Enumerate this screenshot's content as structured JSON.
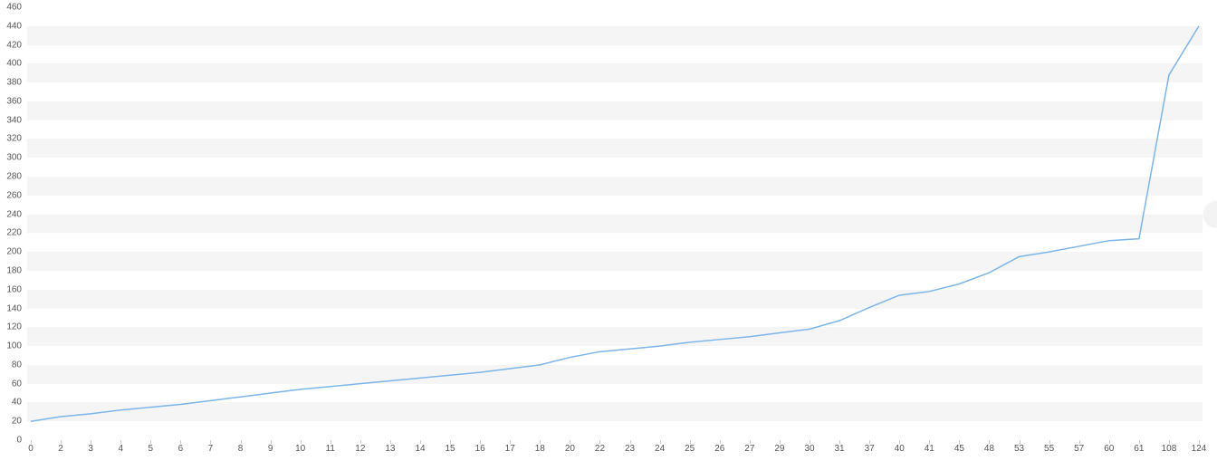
{
  "chart_data": {
    "type": "line",
    "categories": [
      "0",
      "2",
      "3",
      "4",
      "5",
      "6",
      "7",
      "8",
      "9",
      "10",
      "11",
      "12",
      "13",
      "14",
      "15",
      "16",
      "17",
      "18",
      "20",
      "22",
      "23",
      "24",
      "25",
      "26",
      "27",
      "29",
      "30",
      "31",
      "37",
      "40",
      "41",
      "45",
      "48",
      "53",
      "55",
      "57",
      "60",
      "61",
      "108",
      "124"
    ],
    "values": [
      20,
      25,
      28,
      32,
      35,
      38,
      42,
      46,
      50,
      54,
      57,
      60,
      63,
      66,
      69,
      72,
      76,
      80,
      88,
      94,
      97,
      100,
      104,
      107,
      110,
      114,
      118,
      127,
      141,
      154,
      158,
      166,
      178,
      195,
      200,
      206,
      212,
      214,
      388,
      440
    ],
    "title": "",
    "xlabel": "",
    "ylabel": "",
    "ylim": [
      0,
      460
    ],
    "xlim_index": [
      0,
      39
    ],
    "line_color": "#7cb5ec",
    "y_ticks": [
      0,
      20,
      40,
      60,
      80,
      100,
      120,
      140,
      160,
      180,
      200,
      220,
      240,
      260,
      280,
      300,
      320,
      340,
      360,
      380,
      400,
      420,
      440,
      460
    ]
  }
}
